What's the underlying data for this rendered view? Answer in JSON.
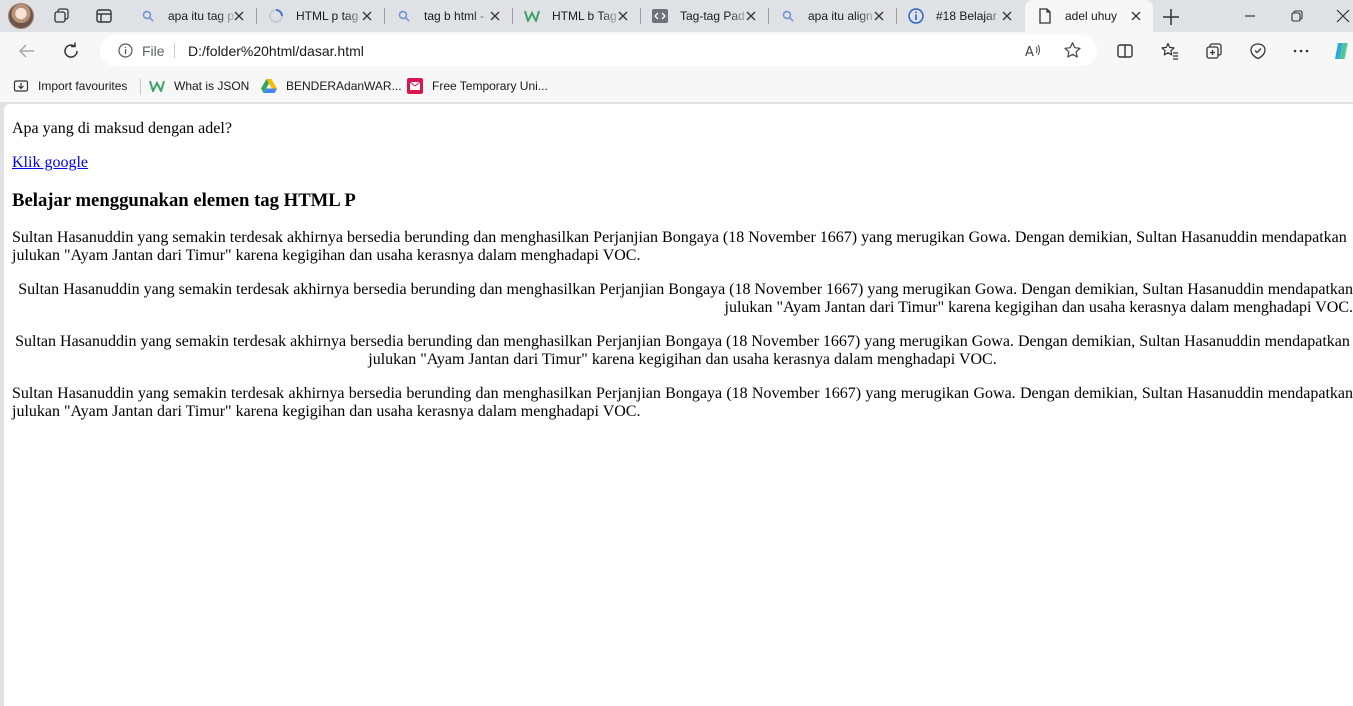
{
  "browser": {
    "tabs": [
      {
        "title": "apa itu tag p",
        "favicon": "search-icon"
      },
      {
        "title": "HTML p tag",
        "favicon": "loading-icon"
      },
      {
        "title": "tag b html -",
        "favicon": "search-icon"
      },
      {
        "title": "HTML b Tag",
        "favicon": "w3schools-icon"
      },
      {
        "title": "Tag-tag Pad",
        "favicon": "code-icon"
      },
      {
        "title": "apa itu align",
        "favicon": "search-icon"
      },
      {
        "title": "#18 Belajar",
        "favicon": "info-icon"
      },
      {
        "title": "adel uhuy",
        "favicon": "page-icon",
        "active": true
      }
    ],
    "address_bar": {
      "protocol_label": "File",
      "url": "D:/folder%20html/dasar.html"
    },
    "favourites": [
      {
        "label": "Import favourites",
        "icon": "import-icon"
      },
      {
        "label": "What is JSON",
        "icon": "w3schools-icon"
      },
      {
        "label": "BENDERAdanWAR...",
        "icon": "google-drive-icon"
      },
      {
        "label": "Free Temporary Uni...",
        "icon": "tempmail-icon"
      }
    ],
    "accent_color": "#0000ee"
  },
  "page": {
    "question": "Apa yang di maksud dengan adel?",
    "link_text": "Klik google",
    "heading": "Belajar menggunakan elemen tag HTML P",
    "paragraphs": [
      {
        "align": "left",
        "text": "Sultan Hasanuddin yang semakin terdesak akhirnya bersedia berunding dan menghasilkan Perjanjian Bongaya (18 November 1667) yang merugikan Gowa. Dengan demikian, Sultan Hasanuddin mendapatkan julukan \"Ayam Jantan dari Timur\" karena kegigihan dan usaha kerasnya dalam menghadapi VOC."
      },
      {
        "align": "right",
        "text": "Sultan Hasanuddin yang semakin terdesak akhirnya bersedia berunding dan menghasilkan Perjanjian Bongaya (18 November 1667) yang merugikan Gowa. Dengan demikian, Sultan Hasanuddin mendapatkan julukan \"Ayam Jantan dari Timur\" karena kegigihan dan usaha kerasnya dalam menghadapi VOC."
      },
      {
        "align": "center",
        "text": "Sultan Hasanuddin yang semakin terdesak akhirnya bersedia berunding dan menghasilkan Perjanjian Bongaya (18 November 1667) yang merugikan Gowa. Dengan demikian, Sultan Hasanuddin mendapatkan julukan \"Ayam Jantan dari Timur\" karena kegigihan dan usaha kerasnya dalam menghadapi VOC."
      },
      {
        "align": "justify",
        "text": "Sultan Hasanuddin yang semakin terdesak akhirnya bersedia berunding dan menghasilkan Perjanjian Bongaya (18 November 1667) yang merugikan Gowa. Dengan demikian, Sultan Hasanuddin mendapatkan julukan \"Ayam Jantan dari Timur\" karena kegigihan dan usaha kerasnya dalam menghadapi VOC."
      }
    ]
  }
}
